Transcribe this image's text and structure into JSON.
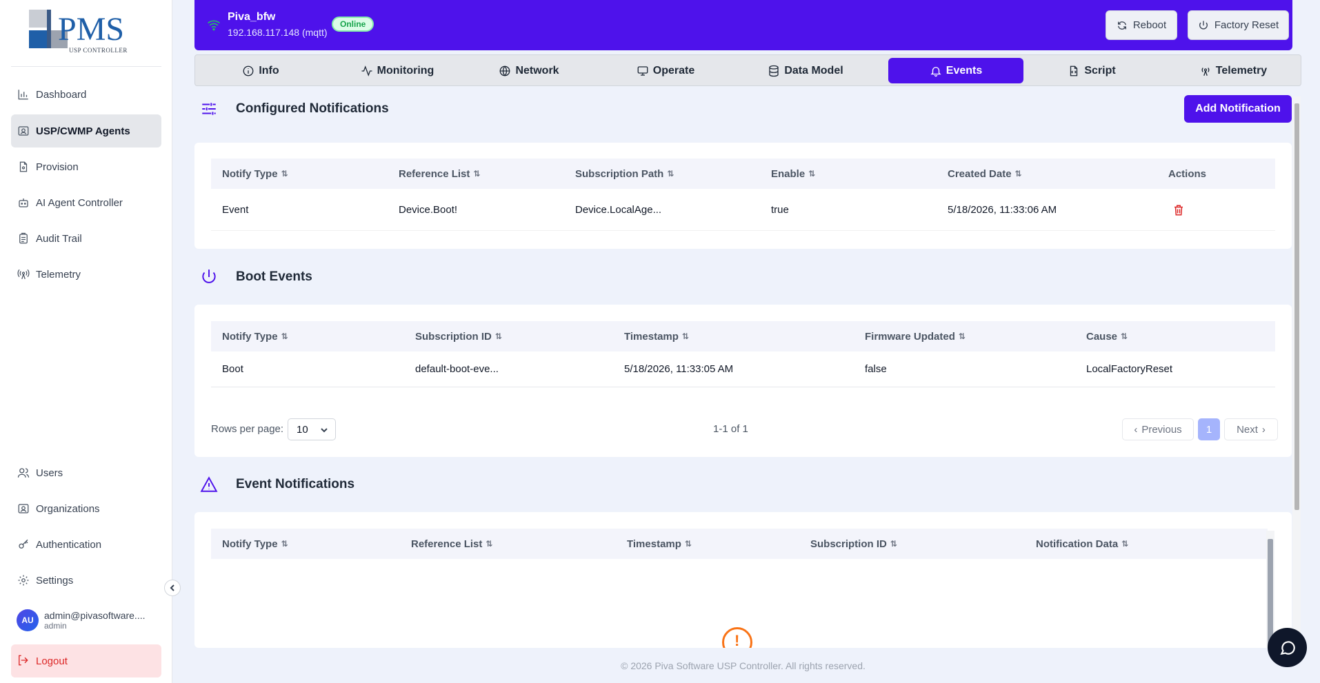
{
  "device": {
    "name": "Piva_bfw",
    "address": "192.168.117.148 (mqtt)",
    "status": "Online"
  },
  "header_buttons": {
    "reboot": "Reboot",
    "factory_reset": "Factory Reset"
  },
  "sidebar": {
    "logo_text": "PMS",
    "logo_subtext": "USP CONTROLLER",
    "items": [
      {
        "label": "Dashboard",
        "icon": "chart-icon"
      },
      {
        "label": "USP/CWMP Agents",
        "icon": "agents-icon"
      },
      {
        "label": "Provision",
        "icon": "file-icon"
      },
      {
        "label": "AI Agent Controller",
        "icon": "robot-icon"
      },
      {
        "label": "Audit Trail",
        "icon": "clipboard-icon"
      },
      {
        "label": "Telemetry",
        "icon": "antenna-icon"
      }
    ],
    "bottom_items": [
      {
        "label": "Users",
        "icon": "users-icon"
      },
      {
        "label": "Organizations",
        "icon": "org-icon"
      },
      {
        "label": "Authentication",
        "icon": "key-icon"
      },
      {
        "label": "Settings",
        "icon": "gear-icon"
      }
    ],
    "user": {
      "initials": "AU",
      "email": "admin@pivasoftware....",
      "role": "admin"
    },
    "logout": "Logout"
  },
  "tabs": [
    "Info",
    "Monitoring",
    "Network",
    "Operate",
    "Data Model",
    "Events",
    "Script",
    "Telemetry"
  ],
  "active_tab": "Events",
  "configured": {
    "title": "Configured Notifications",
    "add_button": "Add Notification",
    "columns": [
      "Notify Type",
      "Reference List",
      "Subscription Path",
      "Enable",
      "Created Date",
      "Actions"
    ],
    "rows": [
      {
        "notify_type": "Event",
        "reference_list": "Device.Boot!",
        "subscription_path": "Device.LocalAge...",
        "enable": "true",
        "created_date": "5/18/2026, 11:33:06 AM"
      }
    ]
  },
  "boot": {
    "title": "Boot Events",
    "columns": [
      "Notify Type",
      "Subscription ID",
      "Timestamp",
      "Firmware Updated",
      "Cause"
    ],
    "rows": [
      {
        "notify_type": "Boot",
        "subscription_id": "default-boot-eve...",
        "timestamp": "5/18/2026, 11:33:05 AM",
        "firmware_updated": "false",
        "cause": "LocalFactoryReset"
      }
    ],
    "pagination": {
      "rows_label": "Rows per page:",
      "rows_value": "10",
      "range": "1-1 of 1",
      "prev": "Previous",
      "page": "1",
      "next": "Next"
    }
  },
  "event_notifications": {
    "title": "Event Notifications",
    "columns": [
      "Notify Type",
      "Reference List",
      "Timestamp",
      "Subscription ID",
      "Notification Data"
    ]
  },
  "footer": "© 2026 Piva Software USP Controller. All rights reserved.",
  "sort_glyph": "⇅"
}
